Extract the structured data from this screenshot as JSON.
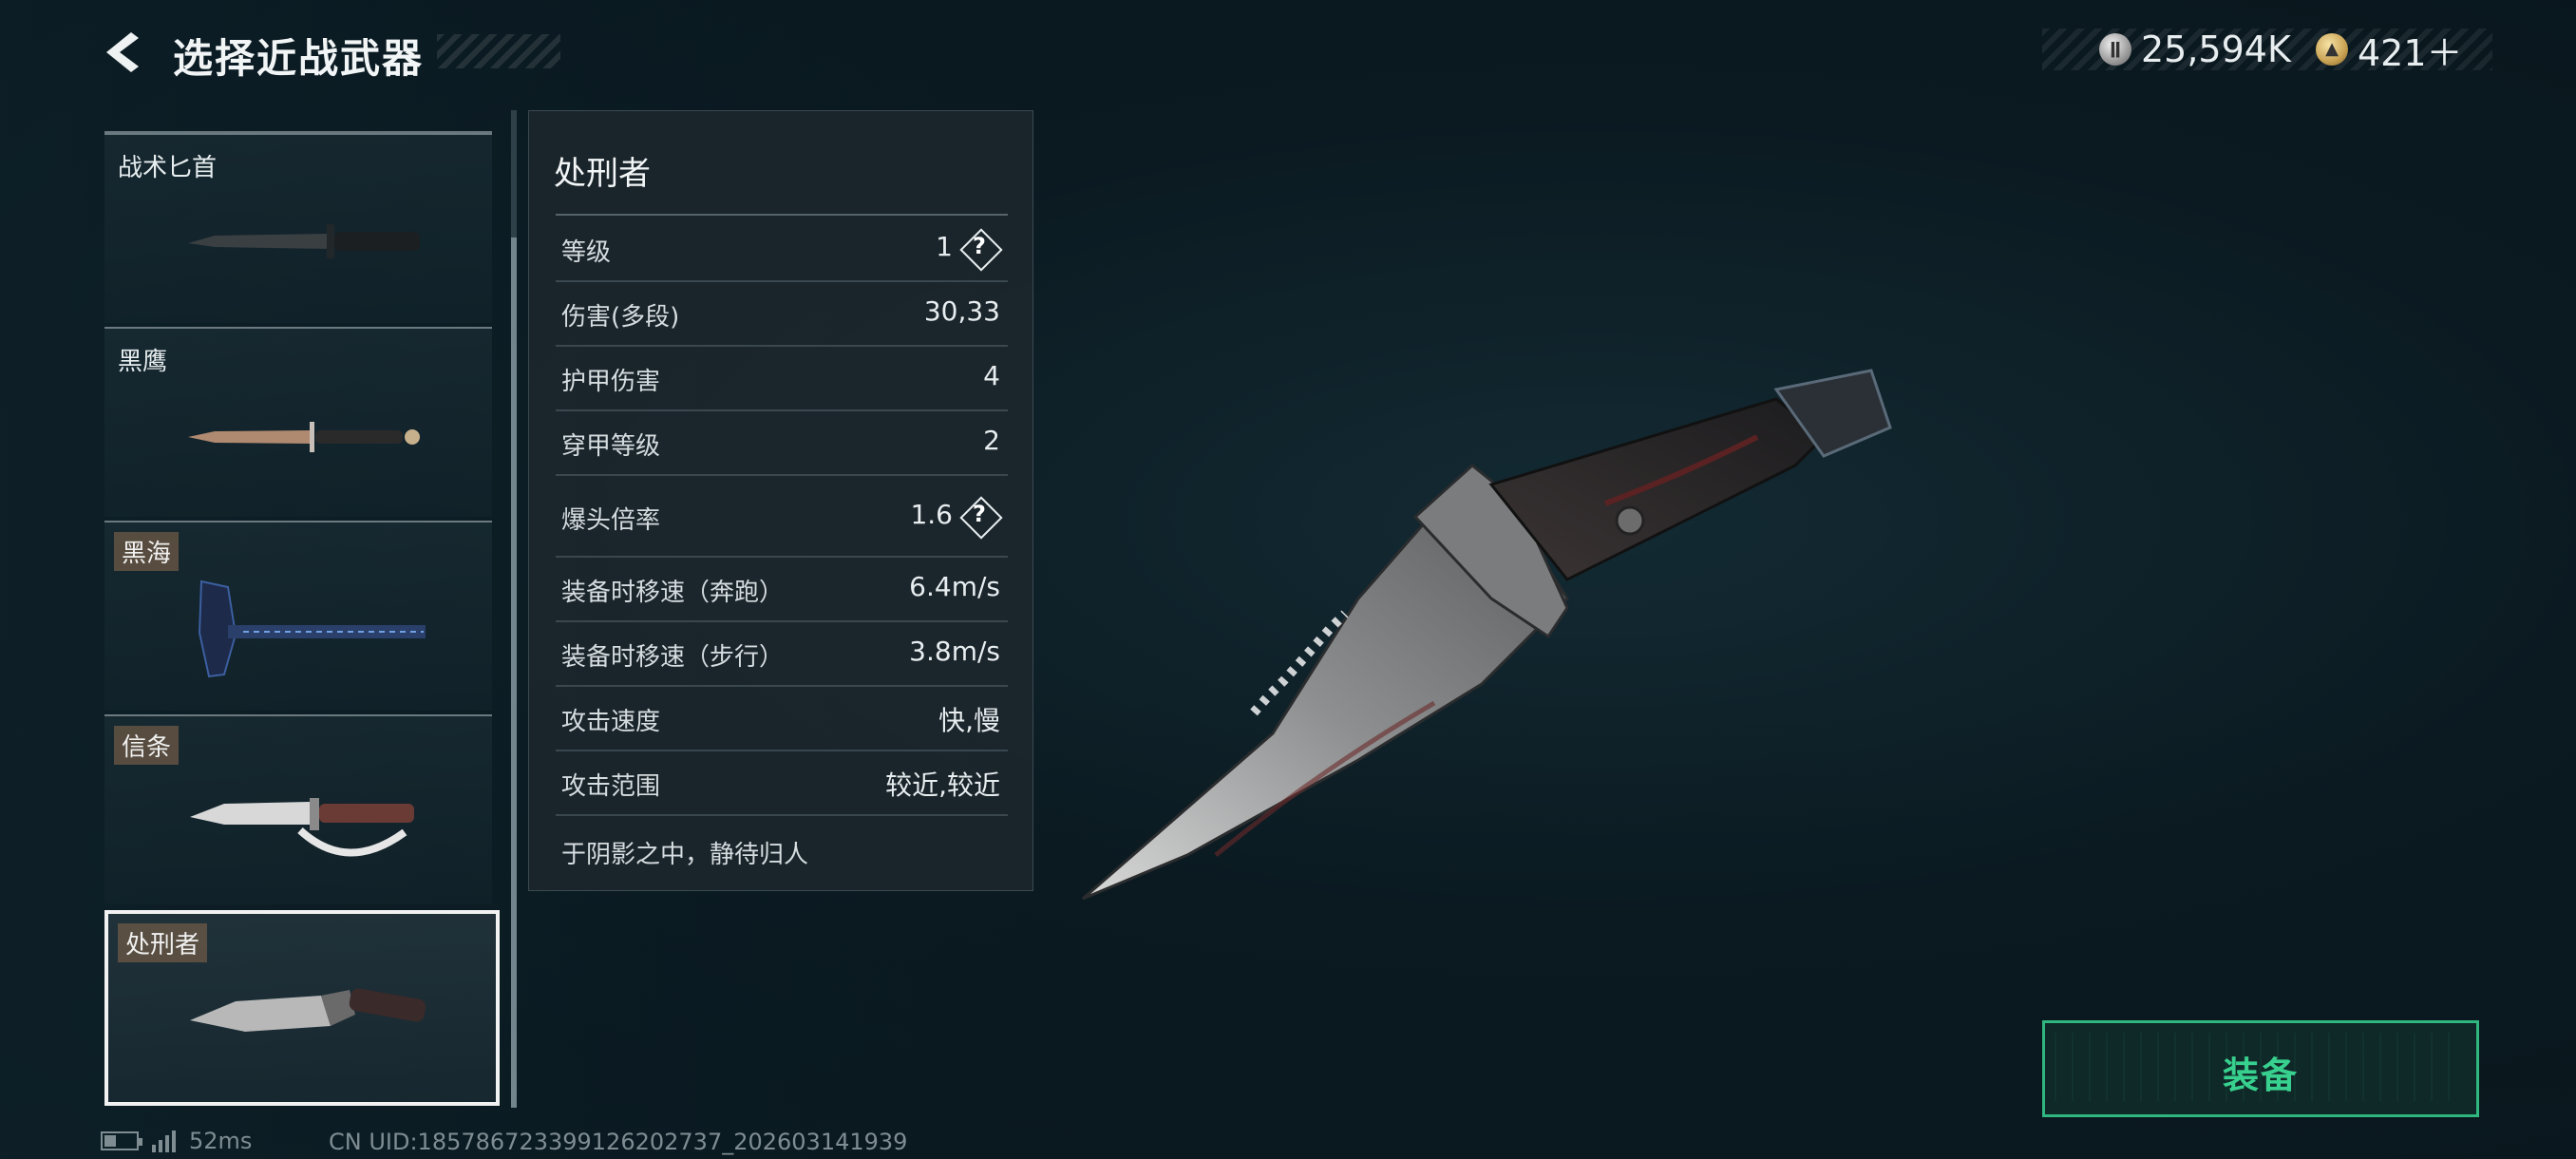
{
  "header": {
    "title": "选择近战武器"
  },
  "currency": {
    "silver_value": "25,594K",
    "gold_value": "421＋",
    "silver_icon": "silver-coin-icon",
    "gold_icon": "gold-coin-icon"
  },
  "weapons": [
    {
      "name": "战术匕首",
      "tagged": false
    },
    {
      "name": "黑鹰",
      "tagged": false
    },
    {
      "name": "黑海",
      "tagged": true
    },
    {
      "name": "信条",
      "tagged": true
    },
    {
      "name": "处刑者",
      "tagged": true,
      "selected": true
    }
  ],
  "detail": {
    "name": "处刑者",
    "stats": [
      {
        "label": "等级",
        "value": "1",
        "help": true
      },
      {
        "label": "伤害(多段)",
        "value": "30,33"
      },
      {
        "label": "护甲伤害",
        "value": "4"
      },
      {
        "label": "穿甲等级",
        "value": "2"
      },
      {
        "label": "爆头倍率",
        "value": "1.6",
        "help": true
      },
      {
        "label": "装备时移速（奔跑）",
        "value": "6.4m/s"
      },
      {
        "label": "装备时移速（步行）",
        "value": "3.8m/s"
      },
      {
        "label": "攻击速度",
        "value": "快,慢"
      },
      {
        "label": "攻击范围",
        "value": "较近,较近"
      }
    ],
    "flavor": "于阴影之中，静待归人",
    "help_symbol": "?"
  },
  "actions": {
    "equip_label": "装备"
  },
  "footer": {
    "ping": "52ms",
    "uid": "CN UID:1857867233991262027​37_202603141939"
  },
  "colors": {
    "accent_green": "#38d08e",
    "panel_bg": "#1c262c",
    "background": "#0b1a21"
  }
}
